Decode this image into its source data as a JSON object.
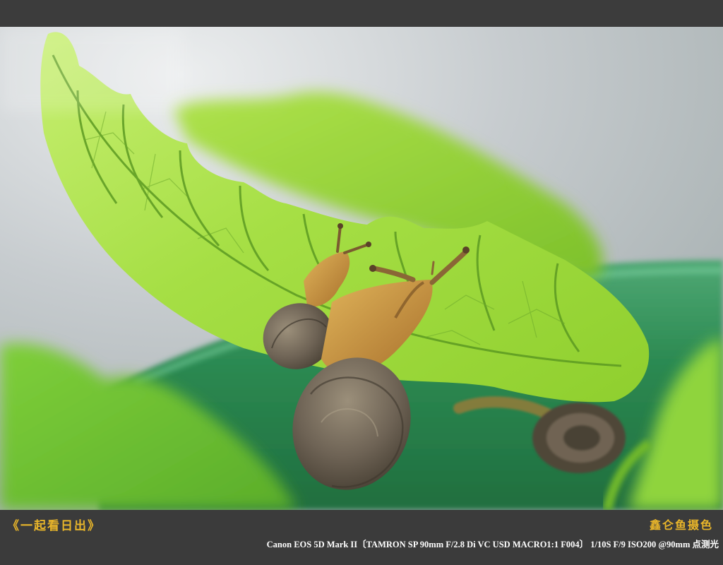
{
  "frame": {
    "album_title": "《一起看日出》",
    "photographer": "鑫仑鱼摄色",
    "exif": "Canon EOS 5D Mark II〔TAMRON SP 90mm F/2.8 Di VC USD MACRO1:1 F004〕 1/10S F/9 ISO200 @90mm 点测光"
  },
  "photo": {
    "subject": "snails on backlit green leaf",
    "colors": {
      "leaf_light": "#b6e65a",
      "leaf_mid": "#8fcf2e",
      "leaf_vein": "#4f8a1c",
      "pot_green": "#2f8b55",
      "snail_body": "#c98a3a",
      "snail_shell": "#6e6355",
      "background": "#c9cdd0"
    }
  }
}
